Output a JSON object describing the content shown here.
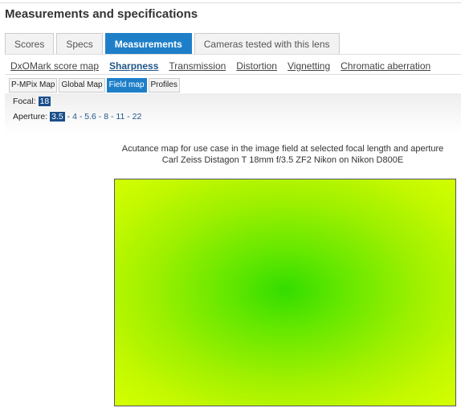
{
  "title": "Measurements and specifications",
  "tabs": [
    "Scores",
    "Specs",
    "Measurements",
    "Cameras tested with this lens"
  ],
  "subtabs": [
    "DxOMark score map",
    "Sharpness",
    "Transmission",
    "Distortion",
    "Vignetting",
    "Chromatic aberration"
  ],
  "maptabs": [
    "P-MPix Map",
    "Global Map",
    "Field map",
    "Profiles"
  ],
  "focal": {
    "label": "Focal:",
    "selected": "18"
  },
  "aperture": {
    "label": "Aperture:",
    "selected": "3.5",
    "options": [
      "4",
      "5.6",
      "8",
      "11",
      "22"
    ]
  },
  "caption": {
    "line1": "Acutance map for use case in the image field at selected focal length and aperture",
    "line2": "Carl Zeiss Distagon T 18mm f/3.5 ZF2 Nikon on Nikon D800E"
  },
  "colors": {
    "accent": "#1e7fc8",
    "map_center": "#33dd00",
    "map_edge": "#d4ff00"
  }
}
